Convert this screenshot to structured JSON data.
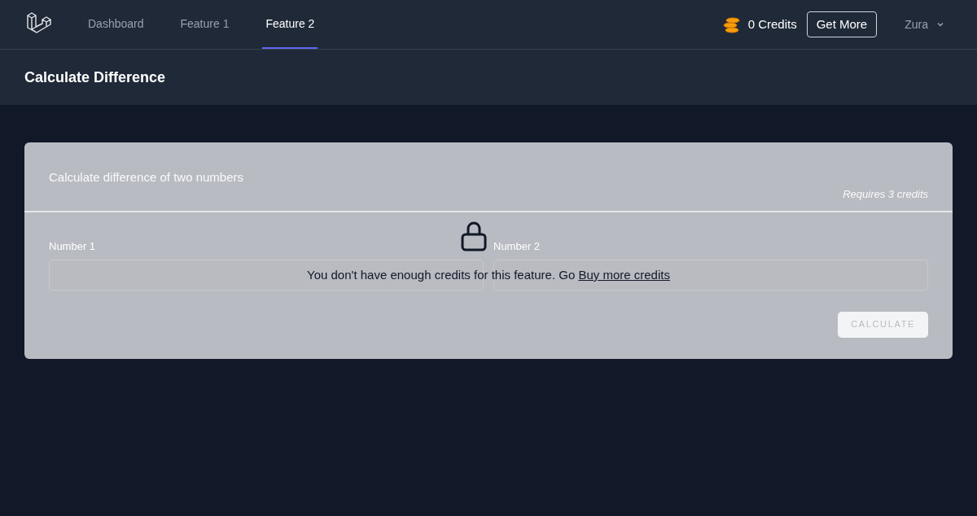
{
  "nav": {
    "links": [
      {
        "label": "Dashboard",
        "selected": false
      },
      {
        "label": "Feature 1",
        "selected": false
      },
      {
        "label": "Feature 2",
        "selected": true
      }
    ],
    "credits": "0 Credits",
    "get_more": "Get More",
    "user": "Zura"
  },
  "header": {
    "title": "Calculate Difference"
  },
  "card": {
    "description": "Calculate difference of two numbers",
    "requirement": "Requires 3 credits",
    "fields": [
      {
        "label": "Number 1"
      },
      {
        "label": "Number 2"
      }
    ],
    "button": {
      "label": "CALCULATE",
      "disabled": true
    },
    "lock": {
      "message": "You don't have enough credits for this feature. Go ",
      "link": "Buy more credits"
    }
  }
}
